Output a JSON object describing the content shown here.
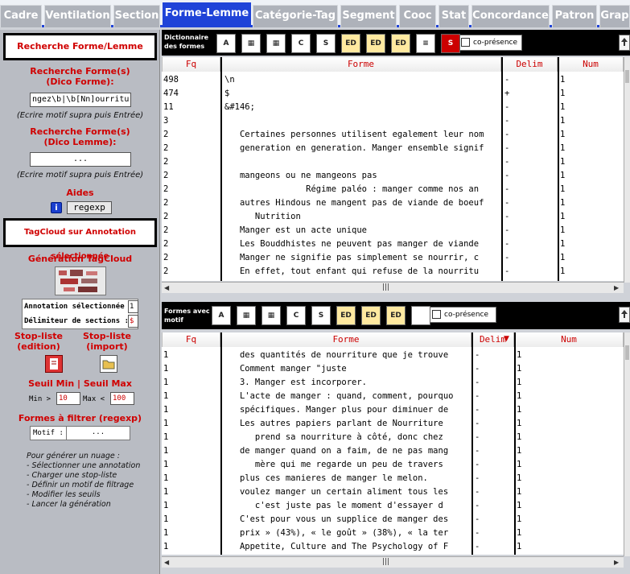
{
  "tabs": [
    "Cadre",
    "Ventilation",
    "Section",
    "Forme-Lemme",
    "Catégorie-Tag",
    "Segment",
    "Cooc",
    "Stat",
    "Concordance",
    "Patron",
    "Grap"
  ],
  "active_tab": "Forme-Lemme",
  "left": {
    "title": "Recherche Forme/Lemme",
    "forme_search_title": "Recherche Forme(s)\n(Dico Forme):",
    "forme_search_value": "ngez\\b|\\b[Nn]ourriture\\b",
    "forme_hint": "(Ecrire motif supra puis Entrée)",
    "lemme_search_title": "Recherche Forme(s)\n(Dico Lemme):",
    "lemme_search_value": "...",
    "lemme_hint": "(Ecrire motif supra puis Entrée)",
    "aides_label": "Aides",
    "info_icon": "i",
    "regexp_label": "regexp",
    "tagcloud_title": "TagCloud sur Annotation sélectionnée",
    "generation_label": "Génération TagCloud",
    "annotation_label": "Annotation sélectionnée :",
    "annotation_value": "1",
    "delimiter_label": "Délimiteur de sections :",
    "delimiter_value": "$",
    "stoplist_edit": "Stop-liste\n(edition)",
    "stoplist_import": "Stop-liste\n(import)",
    "seuil_label": "Seuil Min | Seuil Max",
    "min_label": "Min >",
    "min_value": "10",
    "max_label": "Max <",
    "max_value": "100",
    "filter_title": "Formes à filtrer (regexp)",
    "motif_label": "Motif :",
    "motif_value": "...",
    "help_lines": [
      "Pour générer un nuage :",
      "- Sélectionner une annotation",
      "- Charger une stop-liste",
      "- Définir un motif de filtrage",
      "- Modifier les seuils",
      "- Lancer la génération"
    ]
  },
  "top_panel": {
    "toolbar_label": "Dictionnaire\ndes formes",
    "copresence_label": "co-présence",
    "headers": {
      "fq": "Fq",
      "forme": "Forme",
      "delim": "Delim",
      "num": "Num"
    },
    "rows": [
      {
        "fq": "498",
        "forme": "\\n",
        "delim": "-",
        "num": "1"
      },
      {
        "fq": "474",
        "forme": "$",
        "delim": "+",
        "num": "1"
      },
      {
        "fq": "11",
        "forme": "&#146;",
        "delim": "-",
        "num": "1"
      },
      {
        "fq": "3",
        "forme": "",
        "delim": "-",
        "num": "1"
      },
      {
        "fq": "2",
        "forme": "   Certaines personnes utilisent egalement leur nom",
        "delim": "-",
        "num": "1"
      },
      {
        "fq": "2",
        "forme": "   generation en generation. Manger ensemble signif",
        "delim": "-",
        "num": "1"
      },
      {
        "fq": "2",
        "forme": "",
        "delim": "-",
        "num": "1"
      },
      {
        "fq": "2",
        "forme": "   mangeons ou ne mangeons pas",
        "delim": "-",
        "num": "1"
      },
      {
        "fq": "2",
        "forme": "                Régime paléo : manger comme nos an",
        "delim": "-",
        "num": "1"
      },
      {
        "fq": "2",
        "forme": "   autres Hindous ne mangent pas de viande de boeuf",
        "delim": "-",
        "num": "1"
      },
      {
        "fq": "2",
        "forme": "      Nutrition",
        "delim": "-",
        "num": "1"
      },
      {
        "fq": "2",
        "forme": "   Manger est un acte unique",
        "delim": "-",
        "num": "1"
      },
      {
        "fq": "2",
        "forme": "   Les Bouddhistes ne peuvent pas manger de viande",
        "delim": "-",
        "num": "1"
      },
      {
        "fq": "2",
        "forme": "   Manger ne signifie pas simplement se nourrir, c",
        "delim": "-",
        "num": "1"
      },
      {
        "fq": "2",
        "forme": "   En effet, tout enfant qui refuse de la nourritu",
        "delim": "-",
        "num": "1"
      }
    ]
  },
  "bottom_panel": {
    "toolbar_label": "Formes avec\nmotif",
    "copresence_label": "co-présence",
    "headers": {
      "fq": "Fq",
      "forme": "Forme",
      "delim": "Delim",
      "num": "Num"
    },
    "rows": [
      {
        "fq": "1",
        "forme": "   des quantités de nourriture que je trouve",
        "delim": "-",
        "num": "1"
      },
      {
        "fq": "1",
        "forme": "   Comment manger \"juste",
        "delim": "-",
        "num": "1"
      },
      {
        "fq": "1",
        "forme": "   3. Manger est incorporer.",
        "delim": "-",
        "num": "1"
      },
      {
        "fq": "1",
        "forme": "   L'acte de manger : quand, comment, pourquo",
        "delim": "-",
        "num": "1"
      },
      {
        "fq": "1",
        "forme": "   spécifiques. Manger plus pour diminuer de",
        "delim": "-",
        "num": "1"
      },
      {
        "fq": "1",
        "forme": "   Les autres papiers parlant de Nourriture",
        "delim": "-",
        "num": "1"
      },
      {
        "fq": "1",
        "forme": "      prend sa nourriture à côté, donc chez",
        "delim": "-",
        "num": "1"
      },
      {
        "fq": "1",
        "forme": "   de manger quand on a faim, de ne pas mang",
        "delim": "-",
        "num": "1"
      },
      {
        "fq": "1",
        "forme": "      mère qui me regarde un peu de travers",
        "delim": "-",
        "num": "1"
      },
      {
        "fq": "1",
        "forme": "   plus ces manieres de manger le melon.",
        "delim": "-",
        "num": "1"
      },
      {
        "fq": "1",
        "forme": "   voulez manger un certain aliment tous les",
        "delim": "-",
        "num": "1"
      },
      {
        "fq": "1",
        "forme": "      c'est juste pas le moment d'essayer d",
        "delim": "-",
        "num": "1"
      },
      {
        "fq": "1",
        "forme": "   C'est pour vous un supplice de manger des",
        "delim": "-",
        "num": "1"
      },
      {
        "fq": "1",
        "forme": "   prix » (43%), « le goût » (38%), « la ter",
        "delim": "-",
        "num": "1"
      },
      {
        "fq": "1",
        "forme": "   Appetite, Culture and The Psychology of F",
        "delim": "-",
        "num": "1"
      }
    ]
  },
  "colors": {
    "active_tab": "#1f43d8",
    "header_text": "#cc0000",
    "accent_red": "#d00000"
  }
}
